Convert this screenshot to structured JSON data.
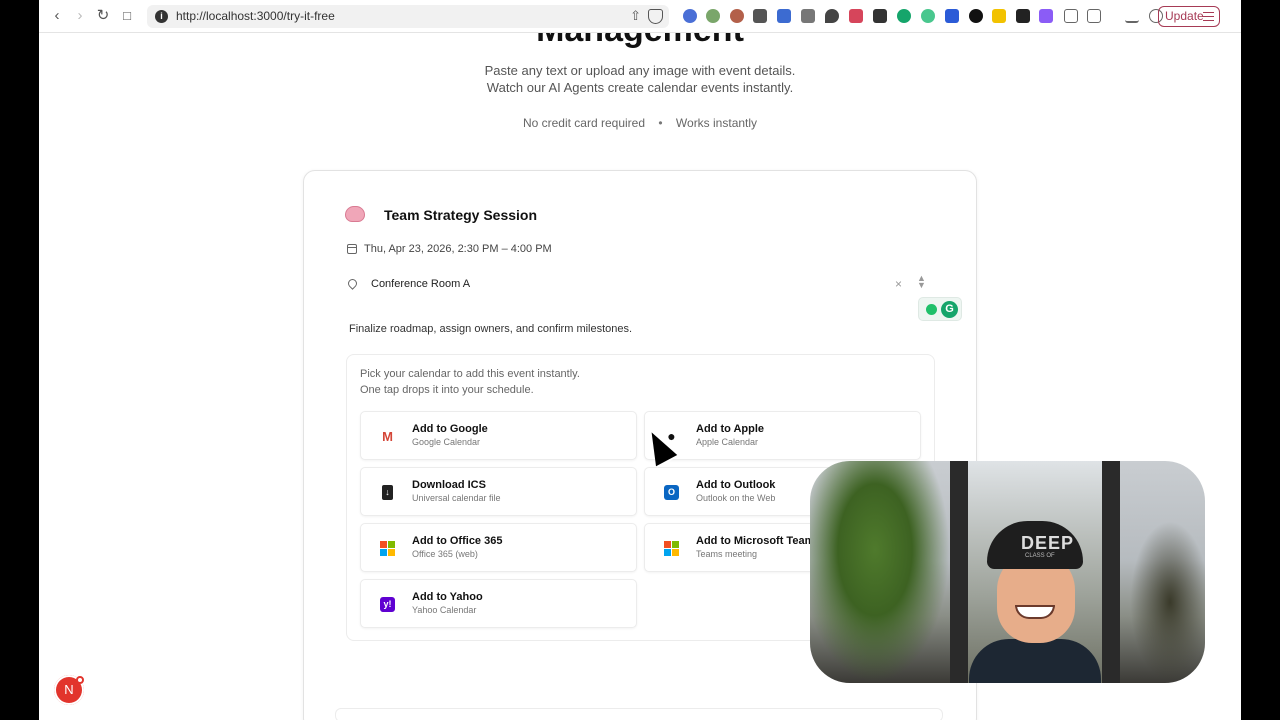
{
  "browser": {
    "url": "http://localhost:3000/try-it-free",
    "update_label": "Update"
  },
  "hero": {
    "heading": "Management",
    "subtitle_line1": "Paste any text or upload any image with event details.",
    "subtitle_line2": "Watch our AI Agents create calendar events instantly.",
    "meta_left": "No credit card required",
    "meta_right": "Works instantly"
  },
  "event": {
    "title": "Team Strategy Session",
    "datetime": "Thu, Apr 23, 2026, 2:30 PM – 4:00 PM",
    "location": "Conference Room A",
    "description": "Finalize roadmap, assign owners, and confirm milestones."
  },
  "picker": {
    "line1": "Pick your calendar to add this event instantly.",
    "line2": "One tap drops it into your schedule.",
    "options": [
      {
        "title": "Add to Google",
        "subtitle": "Google Calendar",
        "icon": "gmail-icon"
      },
      {
        "title": "Add to Apple",
        "subtitle": "Apple Calendar",
        "icon": "apple-icon"
      },
      {
        "title": "Download ICS",
        "subtitle": "Universal calendar file",
        "icon": "file-download-icon"
      },
      {
        "title": "Add to Outlook",
        "subtitle": "Outlook on the Web",
        "icon": "outlook-icon"
      },
      {
        "title": "Add to Office 365",
        "subtitle": "Office 365 (web)",
        "icon": "microsoft-icon"
      },
      {
        "title": "Add to Microsoft Teams",
        "subtitle": "Teams meeting",
        "icon": "microsoft-icon"
      },
      {
        "title": "Add to Yahoo",
        "subtitle": "Yahoo Calendar",
        "icon": "yahoo-icon"
      }
    ]
  },
  "video": {
    "cap_text": "DEEP",
    "cap_subtext": "CLASS OF"
  },
  "next_badge": "N",
  "colors": {
    "accent_update": "#a63a55",
    "grammarly": "#15a56b",
    "yahoo": "#5f01d1",
    "outlook": "#0a66c2"
  }
}
